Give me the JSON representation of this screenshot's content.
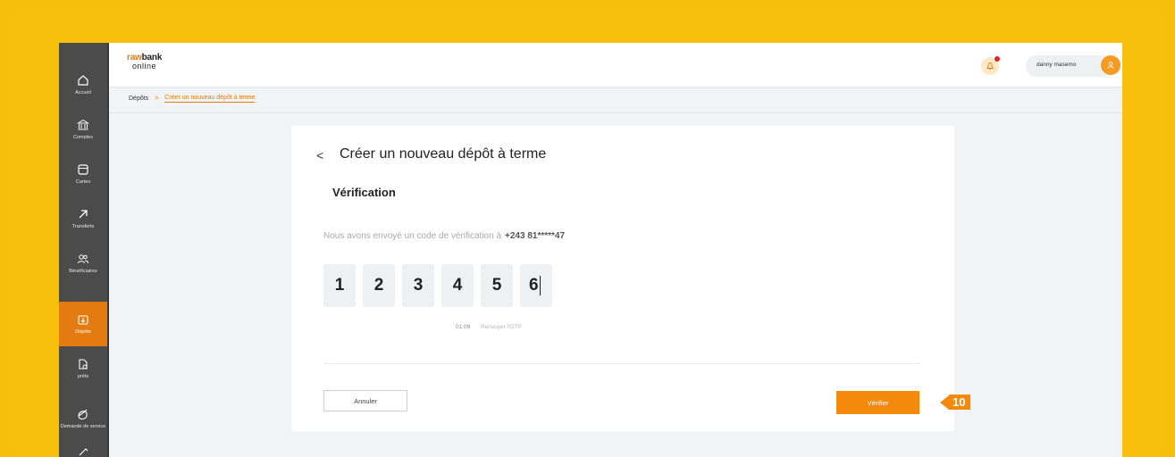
{
  "logo": {
    "line1_a": "raw",
    "line1_b": "bank",
    "line2": "online"
  },
  "header": {
    "user_name": "danny masemo"
  },
  "sidebar": {
    "items": [
      {
        "label": "Accueil",
        "icon": "home-icon"
      },
      {
        "label": "Comptes",
        "icon": "bank-icon"
      },
      {
        "label": "Cartes",
        "icon": "card-icon"
      },
      {
        "label": "Transferts",
        "icon": "arrow-up-right-icon"
      },
      {
        "label": "Bénéficiaires",
        "icon": "users-icon"
      },
      {
        "label": "Dépôts",
        "icon": "deposit-icon",
        "active": true
      },
      {
        "label": "prêts",
        "icon": "loan-icon"
      },
      {
        "label": "Demande de service",
        "icon": "service-icon"
      }
    ]
  },
  "breadcrumb": {
    "root": "Dépôts",
    "separator": ">",
    "current": "Créer un nouveau dépôt à terme"
  },
  "card": {
    "back_symbol": "<",
    "title": "Créer un nouveau dépôt à terme",
    "subtitle": "Vérification",
    "note": "Nous avons envoyé un code de vérification à",
    "phone": "+243 81*****47",
    "otp": [
      "1",
      "2",
      "3",
      "4",
      "5",
      "6"
    ],
    "timer": "01:09",
    "resend": "Renvoyer l'OTP",
    "cancel_label": "Annuler",
    "verify_label": "Vérifier"
  },
  "step_marker": "10",
  "colors": {
    "accent": "#f38a0c",
    "background": "#f6bf0b",
    "sidebar": "#4b4b4b"
  }
}
